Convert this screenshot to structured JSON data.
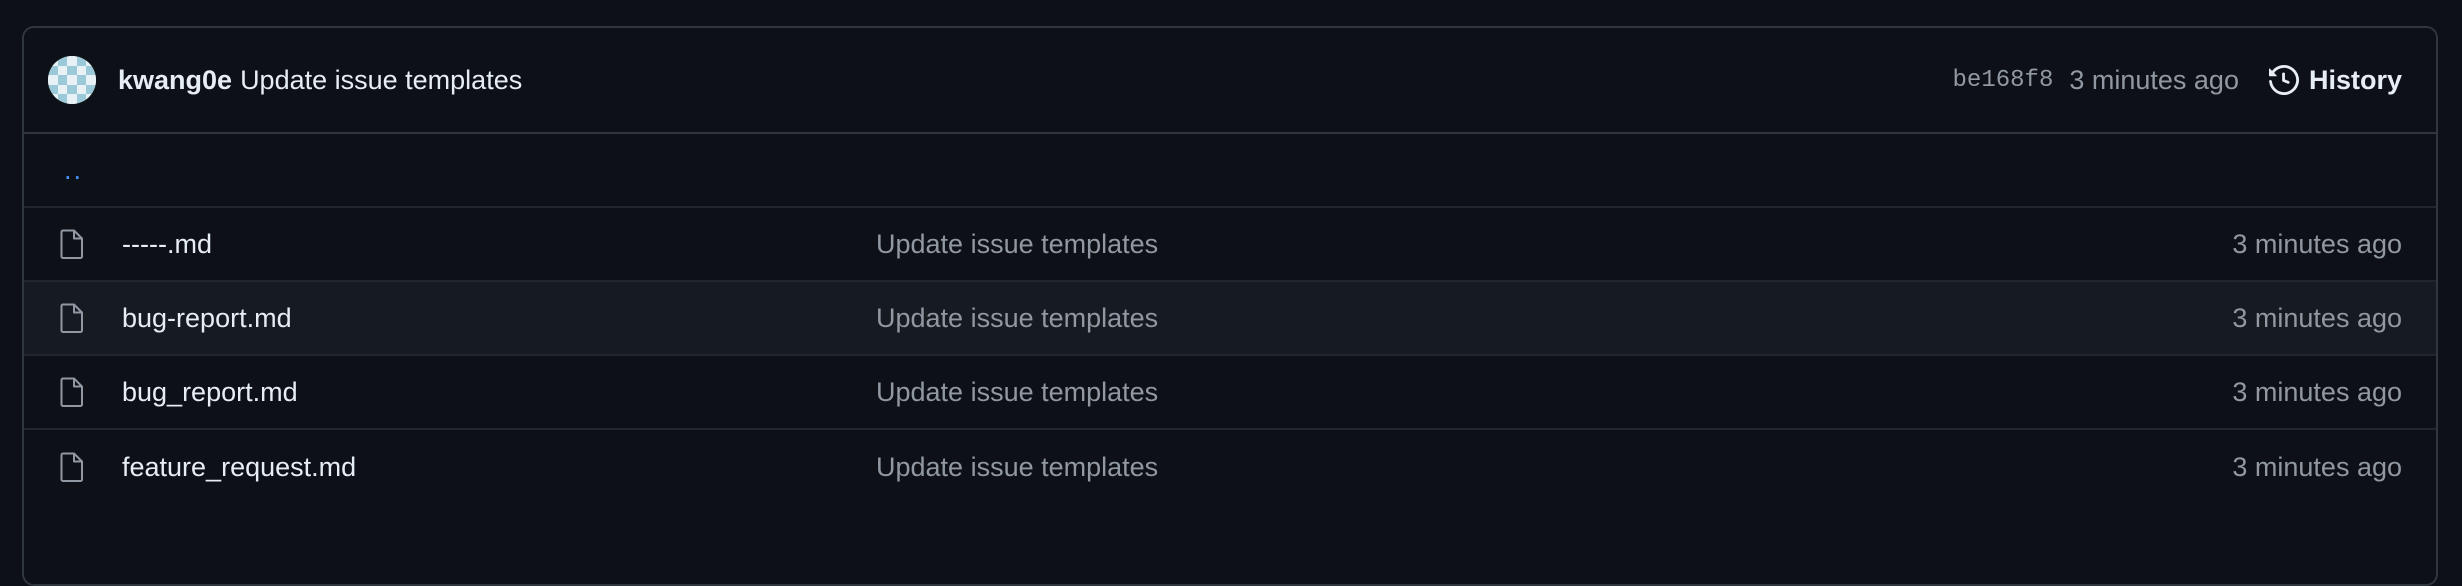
{
  "commit": {
    "author": "kwang0e",
    "message": "Update issue templates",
    "sha": "be168f8",
    "time": "3 minutes ago",
    "history_label": "History"
  },
  "parent_dir": "..",
  "files": [
    {
      "name": "-----.md",
      "commit": "Update issue templates",
      "time": "3 minutes ago",
      "icon": "file-icon"
    },
    {
      "name": "bug-report.md",
      "commit": "Update issue templates",
      "time": "3 minutes ago",
      "icon": "file-icon"
    },
    {
      "name": "bug_report.md",
      "commit": "Update issue templates",
      "time": "3 minutes ago",
      "icon": "file-icon"
    },
    {
      "name": "feature_request.md",
      "commit": "Update issue templates",
      "time": "3 minutes ago",
      "icon": "file-icon"
    }
  ],
  "colors": {
    "background": "#0d1117",
    "border": "#30363d",
    "link": "#4493f8",
    "muted": "#9198a1",
    "text": "#e6edf3",
    "row_hover": "#161b22"
  }
}
